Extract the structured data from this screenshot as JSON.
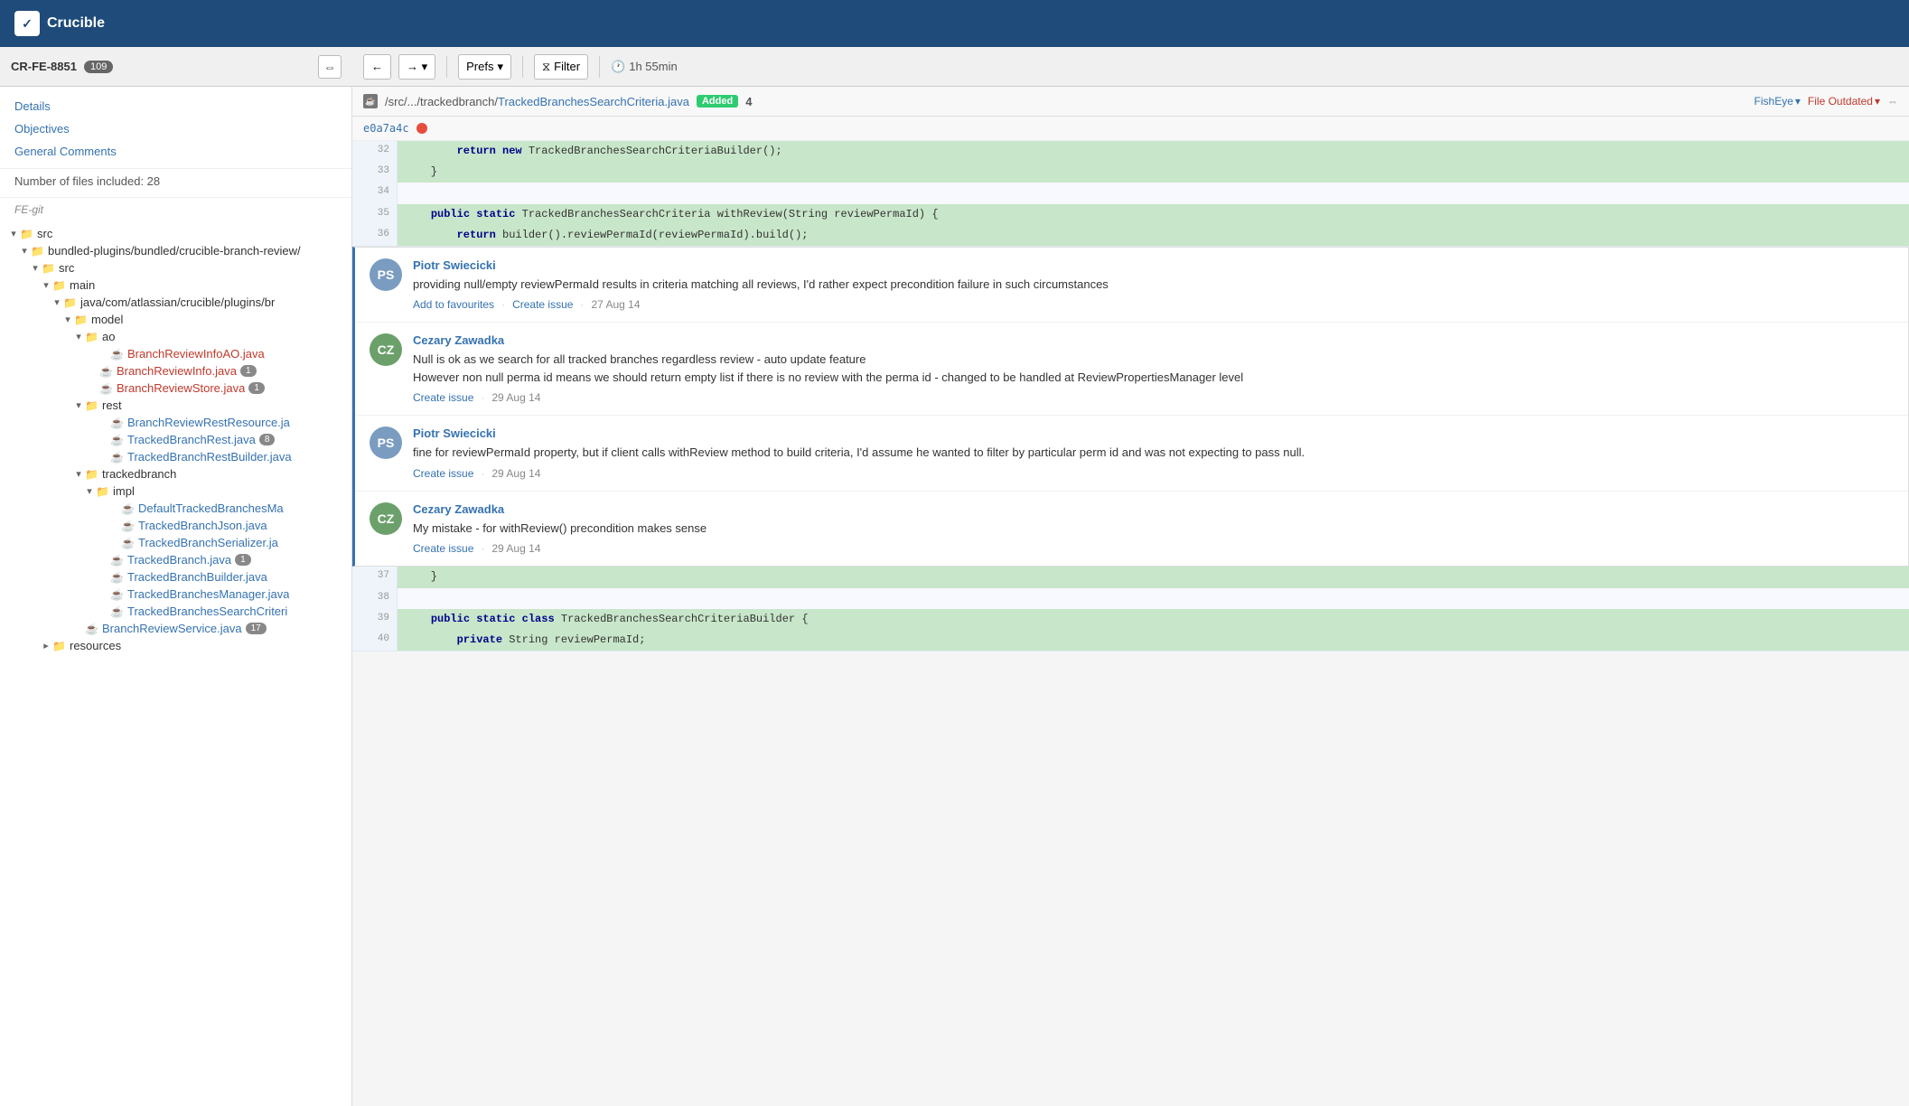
{
  "app": {
    "name": "Crucible",
    "logo_text": "✓"
  },
  "left_header": {
    "cr_id": "CR-FE-8851",
    "badge_count": "109",
    "expand_icon": "⇔"
  },
  "toolbar": {
    "nav_back": "←",
    "nav_forward": "→",
    "nav_dropdown": "▾",
    "prefs_label": "Prefs",
    "prefs_dropdown": "▾",
    "filter_icon": "⧖",
    "filter_label": "Filter",
    "clock_icon": "🕐",
    "time_label": "1h 55min"
  },
  "sidebar_nav": {
    "details_label": "Details",
    "objectives_label": "Objectives",
    "general_comments_label": "General Comments",
    "files_meta": "Number of files included: 28",
    "repo_label": "FE-git"
  },
  "file_tree": {
    "items": [
      {
        "indent": 0,
        "type": "folder",
        "expanded": true,
        "label": "src",
        "badge": null
      },
      {
        "indent": 1,
        "type": "folder",
        "expanded": true,
        "label": "bundled-plugins/bundled/crucible-branch-review/",
        "badge": null
      },
      {
        "indent": 2,
        "type": "folder",
        "expanded": true,
        "label": "src",
        "badge": null
      },
      {
        "indent": 3,
        "type": "folder",
        "expanded": true,
        "label": "main",
        "badge": null
      },
      {
        "indent": 4,
        "type": "folder",
        "expanded": true,
        "label": "java/com/atlassian/crucible/plugins/br",
        "badge": null
      },
      {
        "indent": 5,
        "type": "folder",
        "expanded": true,
        "label": "model",
        "badge": null
      },
      {
        "indent": 6,
        "type": "folder",
        "expanded": true,
        "label": "ao",
        "badge": null
      },
      {
        "indent": 7,
        "type": "file",
        "expanded": false,
        "label": "BranchReviewInfoAO.java",
        "badge": null,
        "color": "red"
      },
      {
        "indent": 6,
        "type": "file",
        "expanded": false,
        "label": "BranchReviewInfo.java",
        "badge": "1",
        "color": "red"
      },
      {
        "indent": 6,
        "type": "file",
        "expanded": false,
        "label": "BranchReviewStore.java",
        "badge": "1",
        "color": "red"
      },
      {
        "indent": 5,
        "type": "folder",
        "expanded": true,
        "label": "rest",
        "badge": null
      },
      {
        "indent": 6,
        "type": "file",
        "expanded": false,
        "label": "BranchReviewRestResource.ja",
        "badge": null,
        "color": "blue"
      },
      {
        "indent": 6,
        "type": "file",
        "expanded": false,
        "label": "TrackedBranchRest.java",
        "badge": "8",
        "color": "blue"
      },
      {
        "indent": 6,
        "type": "file",
        "expanded": false,
        "label": "TrackedBranchRestBuilder.java",
        "badge": null,
        "color": "blue"
      },
      {
        "indent": 5,
        "type": "folder",
        "expanded": true,
        "label": "trackedbranch",
        "badge": null
      },
      {
        "indent": 6,
        "type": "folder",
        "expanded": true,
        "label": "impl",
        "badge": null
      },
      {
        "indent": 7,
        "type": "file",
        "expanded": false,
        "label": "DefaultTrackedBranchesMa",
        "badge": null,
        "color": "blue"
      },
      {
        "indent": 7,
        "type": "file",
        "expanded": false,
        "label": "TrackedBranchJson.java",
        "badge": null,
        "color": "blue"
      },
      {
        "indent": 7,
        "type": "file",
        "expanded": false,
        "label": "TrackedBranchSerializer.ja",
        "badge": null,
        "color": "blue"
      },
      {
        "indent": 6,
        "type": "file",
        "expanded": false,
        "label": "TrackedBranch.java",
        "badge": "1",
        "color": "blue"
      },
      {
        "indent": 6,
        "type": "file",
        "expanded": false,
        "label": "TrackedBranchBuilder.java",
        "badge": null,
        "color": "blue"
      },
      {
        "indent": 6,
        "type": "file",
        "expanded": false,
        "label": "TrackedBranchesManager.java",
        "badge": null,
        "color": "blue"
      },
      {
        "indent": 6,
        "type": "file",
        "expanded": false,
        "label": "TrackedBranchesSearchCriteri",
        "badge": null,
        "color": "blue"
      },
      {
        "indent": 5,
        "type": "file",
        "expanded": false,
        "label": "BranchReviewService.java",
        "badge": "17",
        "color": "blue"
      },
      {
        "indent": 3,
        "type": "folder",
        "expanded": true,
        "label": "resources",
        "badge": null
      }
    ]
  },
  "file_header": {
    "file_icon": "☕",
    "path_prefix": "/src/.../trackedbranch/",
    "file_name": "TrackedBranchesSearchCriteria.java",
    "badge_label": "Added",
    "line_count": "4",
    "fisheye_label": "FishEye",
    "fisheye_dropdown": "▾",
    "outdated_label": "File Outdated",
    "outdated_dropdown": "▾",
    "compare_icon": "⇔"
  },
  "commit": {
    "hash": "e0a7a4c"
  },
  "code_lines": [
    {
      "num": "32",
      "content": "        return new TrackedBranchesSearchCriteriaBuilder();",
      "style": "highlight"
    },
    {
      "num": "33",
      "content": "    }",
      "style": "highlight"
    },
    {
      "num": "34",
      "content": "",
      "style": "normal"
    },
    {
      "num": "35",
      "content": "    public static TrackedBranchesSearchCriteria withReview(String reviewPermaId) {",
      "style": "highlight"
    },
    {
      "num": "36",
      "content": "        return builder().reviewPermaId(reviewPermaId).build();",
      "style": "highlight"
    }
  ],
  "code_lines_bottom": [
    {
      "num": "37",
      "content": "    }",
      "style": "highlight"
    },
    {
      "num": "38",
      "content": "",
      "style": "normal"
    },
    {
      "num": "39",
      "content": "    public static class TrackedBranchesSearchCriteriaBuilder {",
      "style": "highlight"
    },
    {
      "num": "40",
      "content": "        private String reviewPermaId;",
      "style": "highlight"
    }
  ],
  "comments": [
    {
      "id": 1,
      "author": "Piotr Swiecicki",
      "avatar_initials": "PS",
      "avatar_class": "avatar-ps",
      "text": "providing null/empty reviewPermaId results in criteria matching all reviews, I'd rather expect precondition failure in such circumstances",
      "actions": [
        "Add to favourites",
        "Create issue"
      ],
      "date": "27 Aug 14"
    },
    {
      "id": 2,
      "author": "Cezary Zawadka",
      "avatar_initials": "CZ",
      "avatar_class": "avatar-cz",
      "text": "Null is ok as we search for all tracked branches regardless review - auto update feature\nHowever non null perma id means we should return empty list if there is no review with the perma id - changed to be handled at ReviewPropertiesManager level",
      "actions": [
        "Create issue"
      ],
      "date": "29 Aug 14"
    },
    {
      "id": 3,
      "author": "Piotr Swiecicki",
      "avatar_initials": "PS",
      "avatar_class": "avatar-ps",
      "text": "fine for reviewPermaId property, but if client calls withReview method to build criteria, I'd assume he wanted to filter by particular perm id and was not expecting to pass null.",
      "actions": [
        "Create issue"
      ],
      "date": "29 Aug 14"
    },
    {
      "id": 4,
      "author": "Cezary Zawadka",
      "avatar_initials": "CZ",
      "avatar_class": "avatar-cz",
      "text": "My mistake - for withReview() precondition makes sense",
      "actions": [
        "Create issue"
      ],
      "date": "29 Aug 14"
    }
  ]
}
